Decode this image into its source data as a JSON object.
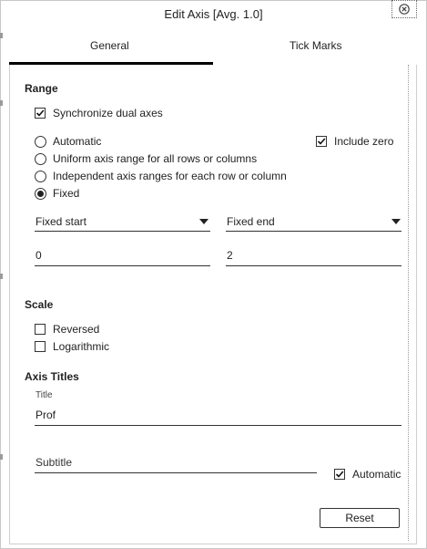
{
  "dialog": {
    "title": "Edit Axis [Avg. 1.0]",
    "close_icon": "close-icon"
  },
  "tabs": [
    {
      "label": "General",
      "selected": true
    },
    {
      "label": "Tick Marks",
      "selected": false
    }
  ],
  "range": {
    "heading": "Range",
    "sync_dual_axes": {
      "label": "Synchronize dual axes",
      "checked": true
    },
    "modes": [
      {
        "label": "Automatic",
        "selected": false
      },
      {
        "label": "Uniform axis range for all rows or columns",
        "selected": false
      },
      {
        "label": "Independent axis ranges for each row or column",
        "selected": false
      },
      {
        "label": "Fixed",
        "selected": true
      }
    ],
    "include_zero": {
      "label": "Include zero",
      "checked": true
    },
    "fixed_start": {
      "select_label": "Fixed start",
      "value": "0"
    },
    "fixed_end": {
      "select_label": "Fixed end",
      "value": "2"
    }
  },
  "scale": {
    "heading": "Scale",
    "reversed": {
      "label": "Reversed",
      "checked": false
    },
    "logarithmic": {
      "label": "Logarithmic",
      "checked": false
    }
  },
  "axis_titles": {
    "heading": "Axis Titles",
    "title_label": "Title",
    "title_value": "Prof",
    "subtitle_placeholder": "Subtitle",
    "automatic": {
      "label": "Automatic",
      "checked": true
    }
  },
  "buttons": {
    "reset": "Reset"
  }
}
